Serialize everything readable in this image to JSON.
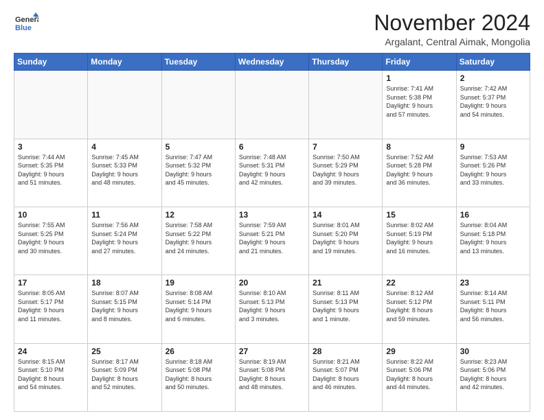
{
  "header": {
    "logo_line1": "General",
    "logo_line2": "Blue",
    "month_title": "November 2024",
    "location": "Argalant, Central Aimak, Mongolia"
  },
  "days_of_week": [
    "Sunday",
    "Monday",
    "Tuesday",
    "Wednesday",
    "Thursday",
    "Friday",
    "Saturday"
  ],
  "weeks": [
    [
      {
        "day": "",
        "info": ""
      },
      {
        "day": "",
        "info": ""
      },
      {
        "day": "",
        "info": ""
      },
      {
        "day": "",
        "info": ""
      },
      {
        "day": "",
        "info": ""
      },
      {
        "day": "1",
        "info": "Sunrise: 7:41 AM\nSunset: 5:38 PM\nDaylight: 9 hours\nand 57 minutes."
      },
      {
        "day": "2",
        "info": "Sunrise: 7:42 AM\nSunset: 5:37 PM\nDaylight: 9 hours\nand 54 minutes."
      }
    ],
    [
      {
        "day": "3",
        "info": "Sunrise: 7:44 AM\nSunset: 5:35 PM\nDaylight: 9 hours\nand 51 minutes."
      },
      {
        "day": "4",
        "info": "Sunrise: 7:45 AM\nSunset: 5:33 PM\nDaylight: 9 hours\nand 48 minutes."
      },
      {
        "day": "5",
        "info": "Sunrise: 7:47 AM\nSunset: 5:32 PM\nDaylight: 9 hours\nand 45 minutes."
      },
      {
        "day": "6",
        "info": "Sunrise: 7:48 AM\nSunset: 5:31 PM\nDaylight: 9 hours\nand 42 minutes."
      },
      {
        "day": "7",
        "info": "Sunrise: 7:50 AM\nSunset: 5:29 PM\nDaylight: 9 hours\nand 39 minutes."
      },
      {
        "day": "8",
        "info": "Sunrise: 7:52 AM\nSunset: 5:28 PM\nDaylight: 9 hours\nand 36 minutes."
      },
      {
        "day": "9",
        "info": "Sunrise: 7:53 AM\nSunset: 5:26 PM\nDaylight: 9 hours\nand 33 minutes."
      }
    ],
    [
      {
        "day": "10",
        "info": "Sunrise: 7:55 AM\nSunset: 5:25 PM\nDaylight: 9 hours\nand 30 minutes."
      },
      {
        "day": "11",
        "info": "Sunrise: 7:56 AM\nSunset: 5:24 PM\nDaylight: 9 hours\nand 27 minutes."
      },
      {
        "day": "12",
        "info": "Sunrise: 7:58 AM\nSunset: 5:22 PM\nDaylight: 9 hours\nand 24 minutes."
      },
      {
        "day": "13",
        "info": "Sunrise: 7:59 AM\nSunset: 5:21 PM\nDaylight: 9 hours\nand 21 minutes."
      },
      {
        "day": "14",
        "info": "Sunrise: 8:01 AM\nSunset: 5:20 PM\nDaylight: 9 hours\nand 19 minutes."
      },
      {
        "day": "15",
        "info": "Sunrise: 8:02 AM\nSunset: 5:19 PM\nDaylight: 9 hours\nand 16 minutes."
      },
      {
        "day": "16",
        "info": "Sunrise: 8:04 AM\nSunset: 5:18 PM\nDaylight: 9 hours\nand 13 minutes."
      }
    ],
    [
      {
        "day": "17",
        "info": "Sunrise: 8:05 AM\nSunset: 5:17 PM\nDaylight: 9 hours\nand 11 minutes."
      },
      {
        "day": "18",
        "info": "Sunrise: 8:07 AM\nSunset: 5:15 PM\nDaylight: 9 hours\nand 8 minutes."
      },
      {
        "day": "19",
        "info": "Sunrise: 8:08 AM\nSunset: 5:14 PM\nDaylight: 9 hours\nand 6 minutes."
      },
      {
        "day": "20",
        "info": "Sunrise: 8:10 AM\nSunset: 5:13 PM\nDaylight: 9 hours\nand 3 minutes."
      },
      {
        "day": "21",
        "info": "Sunrise: 8:11 AM\nSunset: 5:13 PM\nDaylight: 9 hours\nand 1 minute."
      },
      {
        "day": "22",
        "info": "Sunrise: 8:12 AM\nSunset: 5:12 PM\nDaylight: 8 hours\nand 59 minutes."
      },
      {
        "day": "23",
        "info": "Sunrise: 8:14 AM\nSunset: 5:11 PM\nDaylight: 8 hours\nand 56 minutes."
      }
    ],
    [
      {
        "day": "24",
        "info": "Sunrise: 8:15 AM\nSunset: 5:10 PM\nDaylight: 8 hours\nand 54 minutes."
      },
      {
        "day": "25",
        "info": "Sunrise: 8:17 AM\nSunset: 5:09 PM\nDaylight: 8 hours\nand 52 minutes."
      },
      {
        "day": "26",
        "info": "Sunrise: 8:18 AM\nSunset: 5:08 PM\nDaylight: 8 hours\nand 50 minutes."
      },
      {
        "day": "27",
        "info": "Sunrise: 8:19 AM\nSunset: 5:08 PM\nDaylight: 8 hours\nand 48 minutes."
      },
      {
        "day": "28",
        "info": "Sunrise: 8:21 AM\nSunset: 5:07 PM\nDaylight: 8 hours\nand 46 minutes."
      },
      {
        "day": "29",
        "info": "Sunrise: 8:22 AM\nSunset: 5:06 PM\nDaylight: 8 hours\nand 44 minutes."
      },
      {
        "day": "30",
        "info": "Sunrise: 8:23 AM\nSunset: 5:06 PM\nDaylight: 8 hours\nand 42 minutes."
      }
    ]
  ]
}
